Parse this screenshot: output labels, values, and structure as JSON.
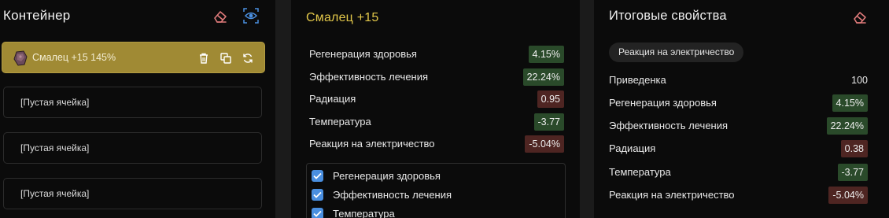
{
  "left": {
    "title": "Контейнер",
    "icons": {
      "clear": "eraser-icon",
      "view": "eye-icon"
    },
    "filled_slot": {
      "label": "Смалец +15 145%",
      "icon": "item-icon"
    },
    "empty_slots": [
      "[Пустая ячейка]",
      "[Пустая ячейка]",
      "[Пустая ячейка]"
    ]
  },
  "middle": {
    "title": "Смалец +15",
    "stats": [
      {
        "name": "Регенерация здоровья",
        "value": "4.15%",
        "tone": "pos"
      },
      {
        "name": "Эффективность лечения",
        "value": "22.24%",
        "tone": "pos"
      },
      {
        "name": "Радиация",
        "value": "0.95",
        "tone": "neg"
      },
      {
        "name": "Температура",
        "value": "-3.77",
        "tone": "pos"
      },
      {
        "name": "Реакция на электричество",
        "value": "-5.04%",
        "tone": "neg"
      }
    ],
    "checklist": [
      {
        "label": "Регенерация здоровья",
        "checked": true
      },
      {
        "label": "Эффективность лечения",
        "checked": true
      },
      {
        "label": "Температура",
        "checked": true
      }
    ]
  },
  "right": {
    "title": "Итоговые свойства",
    "chip": "Реакция на электричество",
    "stats": [
      {
        "name": "Приведенка",
        "value": "100",
        "tone": "plain"
      },
      {
        "name": "Регенерация здоровья",
        "value": "4.15%",
        "tone": "pos"
      },
      {
        "name": "Эффективность лечения",
        "value": "22.24%",
        "tone": "pos"
      },
      {
        "name": "Радиация",
        "value": "0.38",
        "tone": "neg"
      },
      {
        "name": "Температура",
        "value": "-3.77",
        "tone": "pos"
      },
      {
        "name": "Реакция на электричество",
        "value": "-5.04%",
        "tone": "neg"
      }
    ]
  },
  "colors": {
    "accent": "#e3c84a",
    "positive": "#2a4a2a",
    "negative": "#4e2522",
    "selected_slot": "#a08a34",
    "checkbox": "#4a8fe0"
  }
}
